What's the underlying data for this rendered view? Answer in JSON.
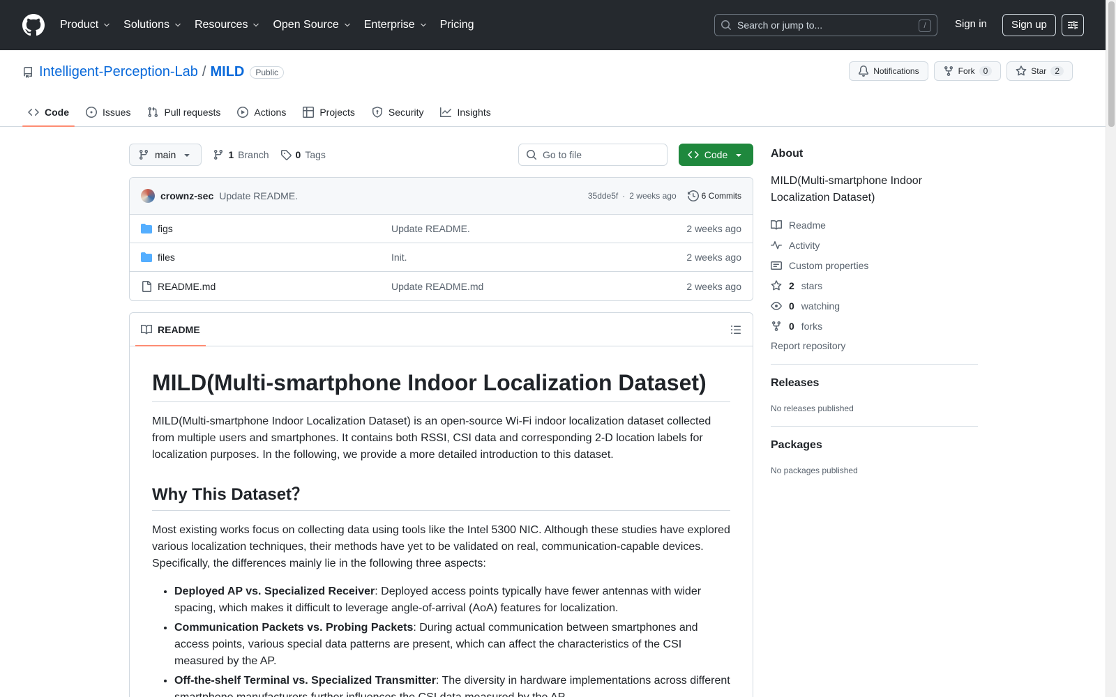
{
  "header": {
    "nav": [
      {
        "label": "Product",
        "chevron": true
      },
      {
        "label": "Solutions",
        "chevron": true
      },
      {
        "label": "Resources",
        "chevron": true
      },
      {
        "label": "Open Source",
        "chevron": true
      },
      {
        "label": "Enterprise",
        "chevron": true
      },
      {
        "label": "Pricing",
        "chevron": false
      }
    ],
    "search_placeholder": "Search or jump to...",
    "search_shortcut": "/",
    "signin": "Sign in",
    "signup": "Sign up"
  },
  "repo": {
    "owner": "Intelligent-Perception-Lab",
    "separator": "/",
    "name": "MILD",
    "visibility": "Public",
    "notifications_label": "Notifications",
    "fork_label": "Fork",
    "fork_count": "0",
    "star_label": "Star",
    "star_count": "2",
    "tabs": [
      {
        "label": "Code",
        "icon": "code-icon"
      },
      {
        "label": "Issues",
        "icon": "issue-icon"
      },
      {
        "label": "Pull requests",
        "icon": "pull-request-icon"
      },
      {
        "label": "Actions",
        "icon": "play-icon"
      },
      {
        "label": "Projects",
        "icon": "table-icon"
      },
      {
        "label": "Security",
        "icon": "shield-icon"
      },
      {
        "label": "Insights",
        "icon": "graph-icon"
      }
    ]
  },
  "toolbar": {
    "branch": "main",
    "branch_count": "1",
    "branch_label": "Branch",
    "tag_count": "0",
    "tag_label": "Tags",
    "goto_placeholder": "Go to file",
    "code_button": "Code"
  },
  "commit": {
    "author": "crownz-sec",
    "message": "Update README.",
    "hash": "35dde5f",
    "dot": "·",
    "time": "2 weeks ago",
    "commits": "6 Commits"
  },
  "files": [
    {
      "name": "figs",
      "type": "folder",
      "message": "Update README.",
      "date": "2 weeks ago"
    },
    {
      "name": "files",
      "type": "folder",
      "message": "Init.",
      "date": "2 weeks ago"
    },
    {
      "name": "README.md",
      "type": "file",
      "message": "Update README.md",
      "date": "2 weeks ago"
    }
  ],
  "readme": {
    "tab_label": "README",
    "h1": "MILD(Multi-smartphone Indoor Localization Dataset)",
    "intro": "MILD(Multi-smartphone Indoor Localization Dataset) is an open-source Wi-Fi indoor localization dataset collected from multiple users and smartphones. It contains both RSSI, CSI data and corresponding 2-D location labels for localization purposes. In the following, we provide a more detailed introduction to this dataset.",
    "h2": "Why This Dataset？",
    "p2": "Most existing works focus on collecting data using tools like the Intel 5300 NIC. Although these studies have explored various localization techniques, their methods have yet to be validated on real, communication-capable devices. Specifically, the differences mainly lie in the following three aspects:",
    "bullets": [
      {
        "bold": "Deployed AP vs. Specialized Receiver",
        "text": ": Deployed access points typically have fewer antennas with wider spacing, which makes it difficult to leverage angle-of-arrival (AoA) features for localization."
      },
      {
        "bold": "Communication Packets vs. Probing Packets",
        "text": ": During actual communication between smartphones and access points, various special data patterns are present, which can affect the characteristics of the CSI measured by the AP."
      },
      {
        "bold": "Off-the-shelf Terminal vs. Specialized Transmitter",
        "text": ": The diversity in hardware implementations across different smartphone manufacturers further influences the CSI data measured by the AP."
      }
    ]
  },
  "sidebar": {
    "about_title": "About",
    "description": "MILD(Multi-smartphone Indoor Localization Dataset)",
    "readme": "Readme",
    "activity": "Activity",
    "custom_properties": "Custom properties",
    "stars_count": "2",
    "stars_label": "stars",
    "watching_count": "0",
    "watching_label": "watching",
    "forks_count": "0",
    "forks_label": "forks",
    "report": "Report repository",
    "releases_title": "Releases",
    "releases_empty": "No releases published",
    "packages_title": "Packages",
    "packages_empty": "No packages published"
  }
}
